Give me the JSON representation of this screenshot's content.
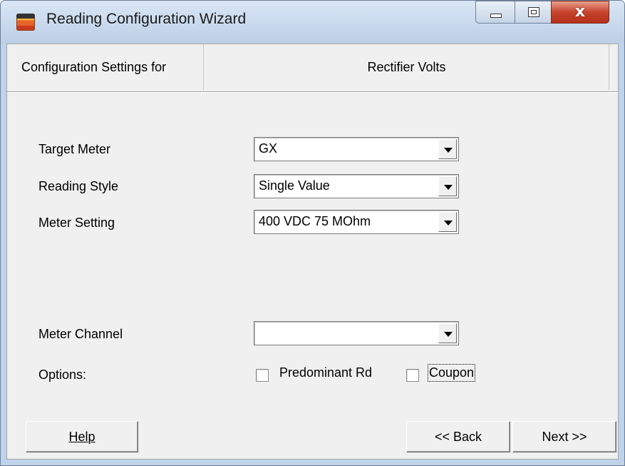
{
  "window": {
    "title": "Reading Configuration Wizard",
    "app_icon": "app-logo-icon",
    "controls": {
      "minimize": "minimize-icon",
      "maximize": "maximize-icon",
      "close_glyph": "x"
    }
  },
  "header": {
    "label": "Configuration Settings for",
    "value": "Rectifier Volts"
  },
  "form": {
    "target_meter": {
      "label": "Target Meter",
      "value": "GX"
    },
    "reading_style": {
      "label": "Reading Style",
      "value": "Single Value"
    },
    "meter_setting": {
      "label": "Meter Setting",
      "value": "400 VDC 75 MOhm"
    },
    "meter_channel": {
      "label": "Meter Channel",
      "value": ""
    },
    "options": {
      "label": "Options:",
      "predominant": {
        "label": "Predominant Rd",
        "checked": false
      },
      "coupon": {
        "label": "Coupon",
        "checked": false
      }
    }
  },
  "buttons": {
    "help": "Help",
    "back": "<< Back",
    "next": "Next >>"
  },
  "colors": {
    "titlebar": "#bccfe6",
    "client": "#f0f0f0",
    "close": "#c7432b"
  }
}
